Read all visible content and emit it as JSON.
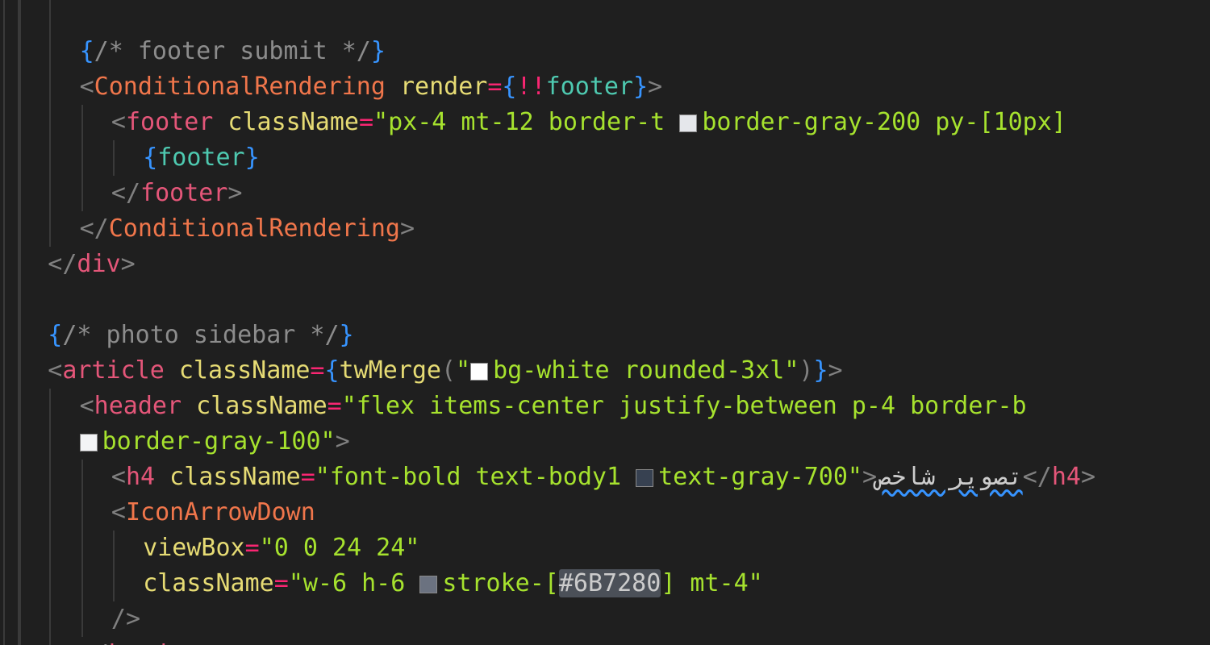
{
  "theme": {
    "background": "#1f1f1f",
    "indent_guide": "#3a3a3a",
    "default": "#cccccc",
    "punct": "#808080",
    "brace": "#3794ff",
    "tag": "#e45679",
    "component": "#f0764b",
    "attr": "#e6db74",
    "string": "#a6e22e",
    "variable": "#4ec9b0",
    "operator": "#f92672",
    "comment": "#8c8c8c",
    "highlight_bg": "#4b5058",
    "squiggle": "#3794ff"
  },
  "lines": [
    {
      "indent": 0,
      "tokens": []
    },
    {
      "indent": 2,
      "tokens": [
        {
          "t": "{",
          "c": "brace"
        },
        {
          "t": "/* footer submit */",
          "c": "comment"
        },
        {
          "t": "}",
          "c": "brace"
        }
      ]
    },
    {
      "indent": 2,
      "tokens": [
        {
          "t": "<",
          "c": "punct"
        },
        {
          "t": "ConditionalRendering",
          "c": "component"
        },
        {
          "t": " ",
          "c": "default"
        },
        {
          "t": "render",
          "c": "attr"
        },
        {
          "t": "=",
          "c": "operator"
        },
        {
          "t": "{",
          "c": "brace"
        },
        {
          "t": "!!",
          "c": "operator"
        },
        {
          "t": "footer",
          "c": "variable"
        },
        {
          "t": "}",
          "c": "brace"
        },
        {
          "t": ">",
          "c": "punct"
        }
      ]
    },
    {
      "indent": 3,
      "tokens": [
        {
          "t": "<",
          "c": "punct"
        },
        {
          "t": "footer",
          "c": "tag"
        },
        {
          "t": " ",
          "c": "default"
        },
        {
          "t": "className",
          "c": "attr"
        },
        {
          "t": "=",
          "c": "operator"
        },
        {
          "t": "\"px-4 mt-12 border-t ",
          "c": "string"
        },
        {
          "swatch": "#e5e7eb"
        },
        {
          "t": "border-gray-200 py-[10px]",
          "c": "string"
        }
      ]
    },
    {
      "indent": 4,
      "tokens": [
        {
          "t": "{",
          "c": "brace"
        },
        {
          "t": "footer",
          "c": "variable"
        },
        {
          "t": "}",
          "c": "brace"
        }
      ]
    },
    {
      "indent": 3,
      "tokens": [
        {
          "t": "</",
          "c": "punct"
        },
        {
          "t": "footer",
          "c": "tag"
        },
        {
          "t": ">",
          "c": "punct"
        }
      ]
    },
    {
      "indent": 2,
      "tokens": [
        {
          "t": "</",
          "c": "punct"
        },
        {
          "t": "ConditionalRendering",
          "c": "component"
        },
        {
          "t": ">",
          "c": "punct"
        }
      ]
    },
    {
      "indent": 1,
      "tokens": [
        {
          "t": "</",
          "c": "punct"
        },
        {
          "t": "div",
          "c": "tag"
        },
        {
          "t": ">",
          "c": "punct"
        }
      ]
    },
    {
      "indent": 0,
      "tokens": []
    },
    {
      "indent": 1,
      "tokens": [
        {
          "t": "{",
          "c": "brace"
        },
        {
          "t": "/* photo sidebar */",
          "c": "comment"
        },
        {
          "t": "}",
          "c": "brace"
        }
      ]
    },
    {
      "indent": 1,
      "tokens": [
        {
          "t": "<",
          "c": "punct"
        },
        {
          "t": "article",
          "c": "tag"
        },
        {
          "t": " ",
          "c": "default"
        },
        {
          "t": "className",
          "c": "attr"
        },
        {
          "t": "=",
          "c": "operator"
        },
        {
          "t": "{",
          "c": "brace"
        },
        {
          "t": "twMerge",
          "c": "attr"
        },
        {
          "t": "(",
          "c": "punct"
        },
        {
          "t": "\"",
          "c": "string"
        },
        {
          "swatch": "#ffffff"
        },
        {
          "t": "bg-white rounded-3xl\"",
          "c": "string"
        },
        {
          "t": ")",
          "c": "punct"
        },
        {
          "t": "}",
          "c": "brace"
        },
        {
          "t": ">",
          "c": "punct"
        }
      ]
    },
    {
      "indent": 2,
      "tokens": [
        {
          "t": "<",
          "c": "punct"
        },
        {
          "t": "header",
          "c": "tag"
        },
        {
          "t": " ",
          "c": "default"
        },
        {
          "t": "className",
          "c": "attr"
        },
        {
          "t": "=",
          "c": "operator"
        },
        {
          "t": "\"flex items-center justify-between p-4 border-b",
          "c": "string"
        }
      ]
    },
    {
      "indent": 2,
      "tokens": [
        {
          "swatch": "#f3f4f6"
        },
        {
          "t": "border-gray-100\"",
          "c": "string"
        },
        {
          "t": ">",
          "c": "punct"
        }
      ]
    },
    {
      "indent": 3,
      "tokens": [
        {
          "t": "<",
          "c": "punct"
        },
        {
          "t": "h4",
          "c": "tag"
        },
        {
          "t": " ",
          "c": "default"
        },
        {
          "t": "className",
          "c": "attr"
        },
        {
          "t": "=",
          "c": "operator"
        },
        {
          "t": "\"font-bold text-body1 ",
          "c": "string"
        },
        {
          "swatch": "#374151"
        },
        {
          "t": "text-gray-700\"",
          "c": "string"
        },
        {
          "t": ">",
          "c": "punct"
        },
        {
          "t": "تصویر شاخص",
          "c": "default",
          "rtl": true
        },
        {
          "t": "</",
          "c": "punct"
        },
        {
          "t": "h4",
          "c": "tag"
        },
        {
          "t": ">",
          "c": "punct"
        }
      ]
    },
    {
      "indent": 3,
      "tokens": [
        {
          "t": "<",
          "c": "punct"
        },
        {
          "t": "IconArrowDown",
          "c": "component"
        }
      ]
    },
    {
      "indent": 4,
      "tokens": [
        {
          "t": "viewBox",
          "c": "attr"
        },
        {
          "t": "=",
          "c": "operator"
        },
        {
          "t": "\"0 0 24 24\"",
          "c": "string"
        }
      ]
    },
    {
      "indent": 4,
      "tokens": [
        {
          "t": "className",
          "c": "attr"
        },
        {
          "t": "=",
          "c": "operator"
        },
        {
          "t": "\"w-6 h-6 ",
          "c": "string"
        },
        {
          "swatch": "#6b7280"
        },
        {
          "t": "stroke-[",
          "c": "string"
        },
        {
          "t": "#6B7280",
          "c": "default",
          "hl": true
        },
        {
          "t": "] mt-4\"",
          "c": "string"
        }
      ]
    },
    {
      "indent": 3,
      "tokens": [
        {
          "t": "/>",
          "c": "punct"
        }
      ]
    },
    {
      "indent": 2,
      "tokens": [
        {
          "t": "</",
          "c": "punct"
        },
        {
          "t": "header",
          "c": "tag"
        },
        {
          "t": ">",
          "c": "punct"
        }
      ]
    }
  ]
}
